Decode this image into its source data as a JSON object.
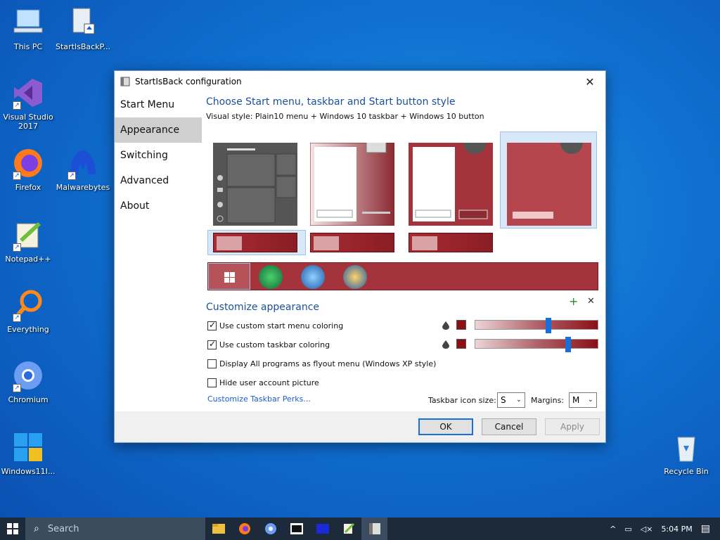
{
  "desktop": {
    "icons": [
      {
        "label": "This PC"
      },
      {
        "label": "StartIsBackP..."
      },
      {
        "label": "Visual Studio 2017"
      },
      {
        "label": "Firefox"
      },
      {
        "label": "Malwarebytes"
      },
      {
        "label": "Notepad++"
      },
      {
        "label": "Everything"
      },
      {
        "label": "Chromium"
      },
      {
        "label": "Windows11I..."
      },
      {
        "label": "Recycle Bin"
      }
    ]
  },
  "dialog": {
    "title": "StartIsBack configuration",
    "nav": [
      "Start Menu",
      "Appearance",
      "Switching",
      "Advanced",
      "About"
    ],
    "heading": "Choose Start menu, taskbar and Start button style",
    "visual_style": "Visual style:  Plain10 menu + Windows 10 taskbar + Windows 10 button",
    "customize_heading": "Customize appearance",
    "options": [
      {
        "label": "Use custom start menu coloring",
        "checked": true,
        "slider": 0.6
      },
      {
        "label": "Use custom taskbar coloring",
        "checked": true,
        "slider": 0.75
      },
      {
        "label": "Display All programs as flyout menu (Windows XP style)",
        "checked": false
      },
      {
        "label": "Hide user account picture",
        "checked": false
      }
    ],
    "link": "Customize Taskbar Perks...",
    "icon_size_label": "Taskbar icon size:",
    "icon_size_value": "S",
    "margins_label": "Margins:",
    "margins_value": "M",
    "buttons": {
      "ok": "OK",
      "cancel": "Cancel",
      "apply": "Apply"
    },
    "accent": "#a5333b"
  },
  "taskbar": {
    "search_placeholder": "Search",
    "clock": "5:04 PM"
  }
}
